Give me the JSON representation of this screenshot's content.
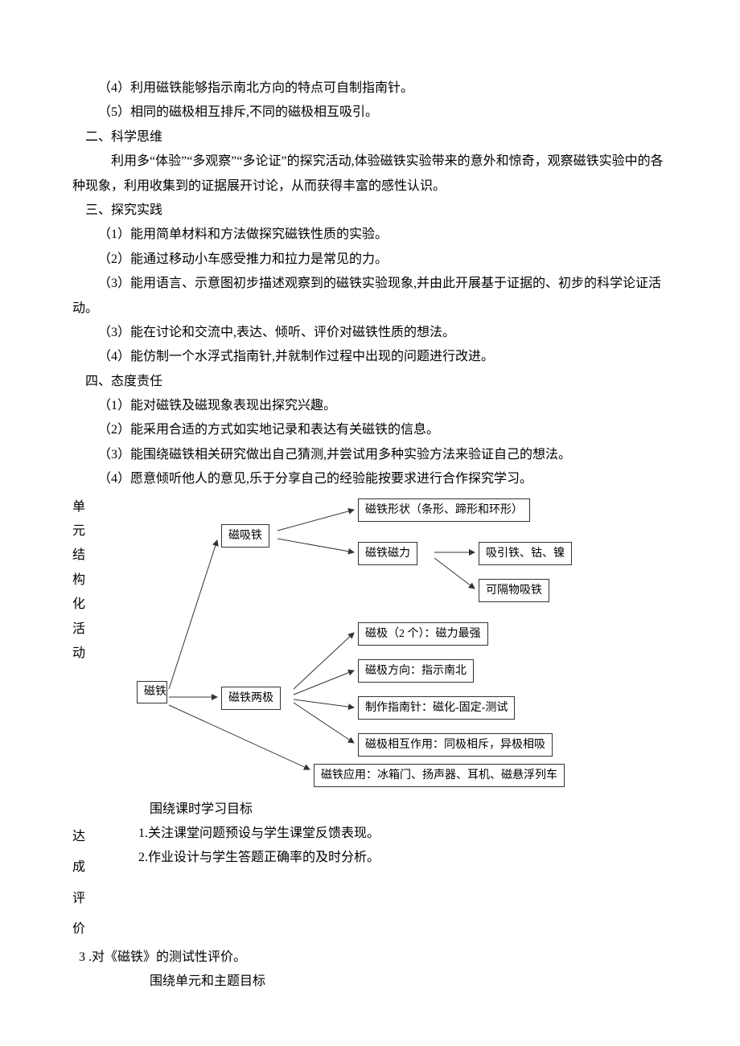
{
  "items": {
    "i4": "（4）利用磁铁能够指示南北方向的特点可自制指南针。",
    "i5": "（5）相同的磁极相互排斥,不同的磁极相互吸引。"
  },
  "sec2": {
    "heading": "二、科学思维",
    "p1": "利用多“体验”“多观察”“多论证”的探究活动,体验磁铁实验带来的意外和惊奇，观察磁铁实验中的各种现象，利用收集到的证据展开讨论，从而获得丰富的感性认识。"
  },
  "sec3": {
    "heading": "三、探究实践",
    "p1": "（1）能用简单材料和方法做探究磁铁性质的实验。",
    "p2": "（2）能通过移动小车感受推力和拉力是常见的力。",
    "p3": "（3）能用语言、示意图初步描述观察到的磁铁实验现象,并由此开展基于证据的、初步的科学论证活动。",
    "p4": "（3）能在讨论和交流中,表达、倾听、评价对磁铁性质的想法。",
    "p5": "（4）能仿制一个水浮式指南针,并就制作过程中出现的问题进行改进。"
  },
  "sec4": {
    "heading": "四、态度责任",
    "p1": "（1）能对磁铁及磁现象表现出探究兴趣。",
    "p2": "（2）能采用合适的方式如实地记录和表达有关磁铁的信息。",
    "p3": "（3）能围绕磁铁相关研究做出自己猜测,并尝试用多种实验方法来验证自己的想法。",
    "p4": "（4）愿意倾听他人的意见,乐于分享自己的经验能按要求进行合作探究学习。"
  },
  "diagram": {
    "side_label": "单 元 结 构 化 活 动",
    "root": "磁铁",
    "n_magattract": "磁吸铁",
    "n_poles": "磁铁两极",
    "n_shape": "磁铁形状（条形、蹄形和环形）",
    "n_force": "磁铁磁力",
    "n_attract": "吸引铁、钴、镍",
    "n_through": "可隔物吸铁",
    "n_polecount": "磁极（2 个）：磁力最强",
    "n_poledir": "磁极方向：指示南北",
    "n_compass": "制作指南针：磁化-固定-测试",
    "n_interact": "磁极相互作用：同极相斥，异极相吸",
    "n_app": "磁铁应用：冰箱门、扬声器、耳机、磁悬浮列车"
  },
  "eval": {
    "center1": "围绕课时学习目标",
    "side": "达成评价",
    "l1": "1.关注课堂问题预设与学生课堂反馈表现。",
    "l2": "2.作业设计与学生答题正确率的及时分析。",
    "l3": "3 .对《磁铁》的测试性评价。",
    "center2": "围绕单元和主题目标"
  }
}
